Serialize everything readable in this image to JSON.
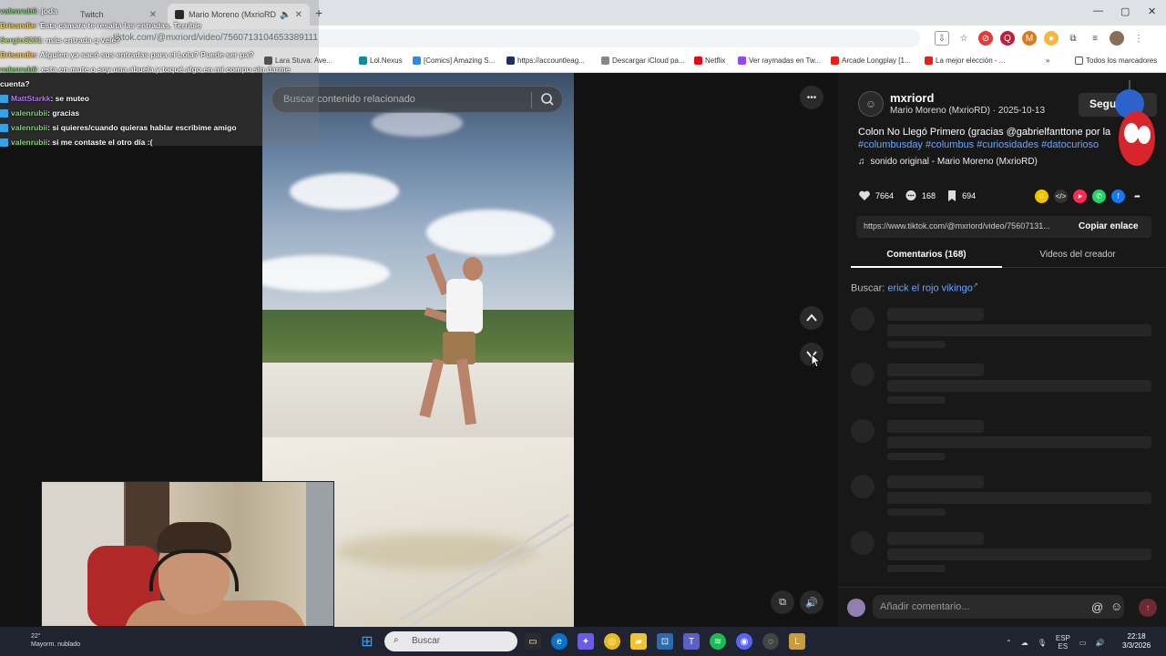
{
  "browser": {
    "tabs": [
      {
        "label": "Twitch",
        "active": false
      },
      {
        "label": "Mario Moreno (MxrioRD) (2...",
        "active": true
      }
    ],
    "new_tab": "+",
    "url": "tiktok.com/@mxriord/video/7560713104653389111",
    "window_controls": {
      "minimize": "—",
      "maximize": "▢",
      "close": "✕"
    },
    "bookmarks": [
      "El Abuelo Stream",
      "Lara Stuva: Ave...",
      "Lol.Nexus",
      "[Comics] Amazing S...",
      "https://accountleag...",
      "Descargar iCloud pa...",
      "Netflix",
      "Ver raymadas en Tw...",
      "Arcade Longplay [1...",
      "La mejor elección - ...",
      "»",
      "Todos los marcadores"
    ]
  },
  "chat": [
    {
      "user": "valenrubii",
      "color": "#86d07c",
      "text": ": joda"
    },
    {
      "user": "Brisandie",
      "color": "#ffd15a",
      "text": ": Esta cámara te resalta las entradas. Terrible"
    },
    {
      "user": "Sergio3231",
      "color": "#b6e07a",
      "text": ": más entrada q vele?"
    },
    {
      "user": "Brisandie",
      "color": "#ffd15a",
      "text": ": Alguien ya sacó sus entradas para el Lola? Puede ser pa?"
    },
    {
      "user": "valenrubii",
      "color": "#86d07c",
      "text": ": esta en mute o soy una abuela y toqué algo en mi compu sin darme"
    },
    {
      "user": "",
      "color": "#ffffff",
      "text": "cuenta?"
    },
    {
      "user": "MattStarkk",
      "color": "#c078ff",
      "text": ": se muteo"
    },
    {
      "user": "valenrubii",
      "color": "#86d07c",
      "text": ": gracias"
    },
    {
      "user": "valenrubii",
      "color": "#86d07c",
      "text": ": si quieres/cuando quieras hablar escribime amigo"
    },
    {
      "user": "valenrubii",
      "color": "#86d07c",
      "text": ": si me contaste el otro día :("
    }
  ],
  "search": {
    "placeholder": "Buscar contenido relacionado"
  },
  "video_controls": {
    "more": "•••",
    "up": "⌃",
    "down": "⌄",
    "volume": "🔊"
  },
  "post": {
    "username": "mxriord",
    "display_name": "Mario Moreno (MxrioRD)",
    "date": "2025-10-13",
    "subline": "Mario Moreno (MxrioRD) · 2025-10-13",
    "follow_label": "Seguir",
    "description": "Colon No Llegó Primero (gracias @gabrielfanttone por la",
    "hashtags": "#columbusday #columbus #curiosidades #datocurioso",
    "sound": "sonido original - Mario Moreno (MxrioRD)",
    "likes": "7664",
    "comments": "168",
    "saves": "694",
    "link": "https://www.tiktok.com/@mxriord/video/75607131...",
    "copy_label": "Copiar enlace",
    "tab_comments": "Comentarios (168)",
    "tab_creator": "Videos del creador",
    "search_prefix": "Buscar:",
    "search_term": "erick el rojo vikingo",
    "comment_placeholder": "Añadir comentario..."
  },
  "taskbar": {
    "weather_temp": "22°",
    "weather_desc": "Mayorm. nublado",
    "search_label": "Buscar",
    "lang": "ESP",
    "lang2": "ES",
    "time": "22:18",
    "date": "3/3/2026"
  },
  "colors": {
    "accent_blue": "#6ca6ff",
    "tiktok_red": "#fe2c55",
    "panel_bg": "#181818"
  }
}
